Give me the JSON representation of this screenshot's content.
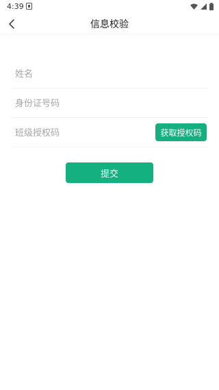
{
  "status_bar": {
    "time": "4:39",
    "icons": [
      "notification-icon",
      "wifi-icon",
      "signal-icon",
      "battery-icon"
    ]
  },
  "header": {
    "title": "信息校验",
    "back_icon": "chevron-left-icon"
  },
  "form": {
    "name_placeholder": "姓名",
    "id_placeholder": "身份证号码",
    "auth_code_placeholder": "班级授权码",
    "get_auth_code_label": "获取授权码"
  },
  "submit_label": "提交",
  "colors": {
    "accent": "#15b07f",
    "placeholder": "#a6a6a6",
    "divider": "#f2f2f2"
  }
}
